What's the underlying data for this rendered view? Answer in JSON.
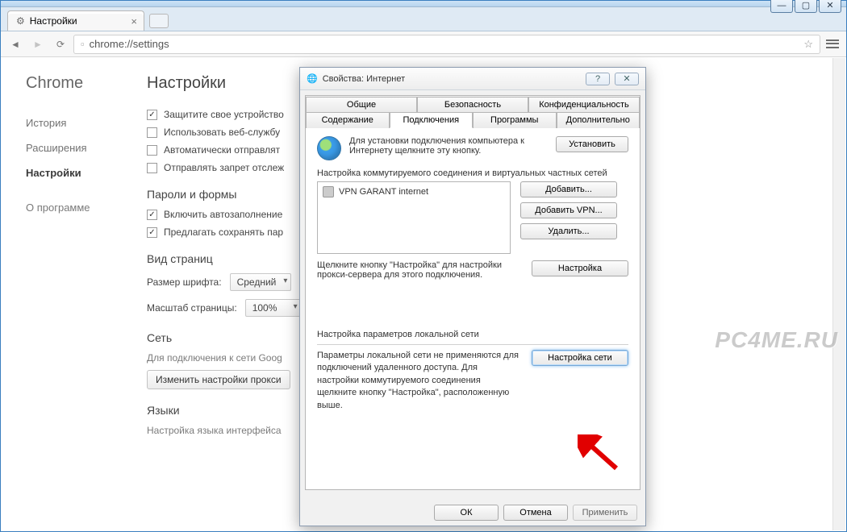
{
  "window": {
    "minimize": "—",
    "maximize": "▢",
    "close": "✕"
  },
  "browser": {
    "tab_title": "Настройки",
    "omnibox": "chrome://settings",
    "star_icon": "☆"
  },
  "sidebar": {
    "brand": "Chrome",
    "items": [
      "История",
      "Расширения",
      "Настройки"
    ],
    "about": "О программе"
  },
  "page": {
    "title": "Настройки",
    "privacy": {
      "items": [
        {
          "checked": true,
          "label": "Защитите свое устройство"
        },
        {
          "checked": false,
          "label": "Использовать веб-службу"
        },
        {
          "checked": false,
          "label": "Автоматически отправлят"
        },
        {
          "checked": false,
          "label": "Отправлять запрет отслеж"
        }
      ]
    },
    "passwords": {
      "heading": "Пароли и формы",
      "items": [
        {
          "checked": true,
          "label": "Включить автозаполнение"
        },
        {
          "checked": true,
          "label": "Предлагать сохранять пар"
        }
      ]
    },
    "appearance": {
      "heading": "Вид страниц",
      "font_label": "Размер шрифта:",
      "font_value": "Средний",
      "zoom_label": "Масштаб страницы:",
      "zoom_value": "100%"
    },
    "network": {
      "heading": "Сеть",
      "desc": "Для подключения к сети Goog",
      "button": "Изменить настройки прокси"
    },
    "lang": {
      "heading": "Языки",
      "desc": "Настройка языка интерфейса"
    }
  },
  "dialog": {
    "title": "Свойства: Интернет",
    "tabs_top": [
      "Общие",
      "Безопасность",
      "Конфиденциальность"
    ],
    "tabs_bottom": [
      "Содержание",
      "Подключения",
      "Программы",
      "Дополнительно"
    ],
    "active_tab": "Подключения",
    "setup_text": "Для установки подключения компьютера к Интернету щелкните эту кнопку.",
    "setup_btn": "Установить",
    "dialup_heading": "Настройка коммутируемого соединения и виртуальных частных сетей",
    "list_item": "VPN GARANT internet",
    "btn_add": "Добавить...",
    "btn_add_vpn": "Добавить VPN...",
    "btn_delete": "Удалить...",
    "btn_settings": "Настройка",
    "proxy_hint": "Щелкните кнопку \"Настройка\" для настройки прокси-сервера для этого подключения.",
    "lan_heading": "Настройка параметров локальной сети",
    "lan_text": "Параметры локальной сети не применяются для подключений удаленного доступа. Для настройки коммутируемого соединения щелкните кнопку \"Настройка\", расположенную выше.",
    "lan_btn": "Настройка сети",
    "ok": "ОК",
    "cancel": "Отмена",
    "apply": "Применить"
  },
  "watermark": "PC4ME.RU"
}
